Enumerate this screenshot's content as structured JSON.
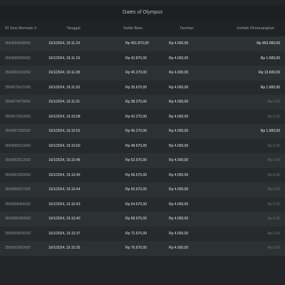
{
  "window": {
    "title": "Gates of Olympus"
  },
  "table": {
    "headers": [
      "ID Sesi Bermain #",
      "Tanggal",
      "Saldo Baru",
      "Taruhan",
      "Jumlah Dimenangkan"
    ],
    "rows": [
      [
        "3569684938092",
        "16/1/2024, 19.11.24",
        "Rp 491.870,00",
        "Rp 4.000,00",
        "Rp 453.000,00"
      ],
      [
        "3569680589092",
        "16/1/2024, 19.11.19",
        "Rp 42.870,00",
        "Rp 4.000,00",
        "Rp 1.600,00"
      ],
      [
        "3569681930092",
        "16/1/2024, 19.11.08",
        "Rp 45.270,00",
        "Rp 4.000,00",
        "Rp 13.600,00"
      ],
      [
        "3569676621092",
        "16/1/2024, 19.11.03",
        "Rp 35.670,00",
        "Rp 4.000,00",
        "Rp 1.600,00"
      ],
      [
        "3569674679092",
        "16/1/2024, 19.11.01",
        "Rp 38.270,00",
        "Rp 4.000,00",
        "Rp 0,00"
      ],
      [
        "3569672563092",
        "16/1/2024, 19.10.58",
        "Rp 42.270,00",
        "Rp 4.000,00",
        "Rp 0,00"
      ],
      [
        "3569667556092",
        "16/1/2024, 19.10.52",
        "Rp 46.270,00",
        "Rp 4.000,00",
        "Rp 1.600,00"
      ],
      [
        "3569665519092",
        "16/1/2024, 19.10.50",
        "Rp 48.670,00",
        "Rp 4.000,00",
        "Rp 0,00"
      ],
      [
        "3569663512092",
        "16/1/2024, 19.10.48",
        "Rp 52.670,00",
        "Rp 4.000,00",
        "Rp 0,00"
      ],
      [
        "3569661809092",
        "16/1/2024, 19.10.46",
        "Rp 56.670,00",
        "Rp 4.000,00",
        "Rp 0,00"
      ],
      [
        "3569660527092",
        "16/1/2024, 19.10.44",
        "Rp 60.670,00",
        "Rp 4.000,00",
        "Rp 0,00"
      ],
      [
        "3569658405092",
        "16/1/2024, 19.10.43",
        "Rp 64.670,00",
        "Rp 4.000,00",
        "Rp 0,00"
      ],
      [
        "3569656483092",
        "16/1/2024, 19.10.40",
        "Rp 68.670,00",
        "Rp 4.000,00",
        "Rp 0,00"
      ],
      [
        "3569654656092",
        "16/1/2024, 19.10.37",
        "Rp 72.670,00",
        "Rp 4.000,00",
        "Rp 0,00"
      ],
      [
        "3569652669092",
        "16/1/2024, 19.10.35",
        "Rp 76.670,00",
        "Rp 4.000,00",
        "Rp 0,00"
      ]
    ]
  }
}
